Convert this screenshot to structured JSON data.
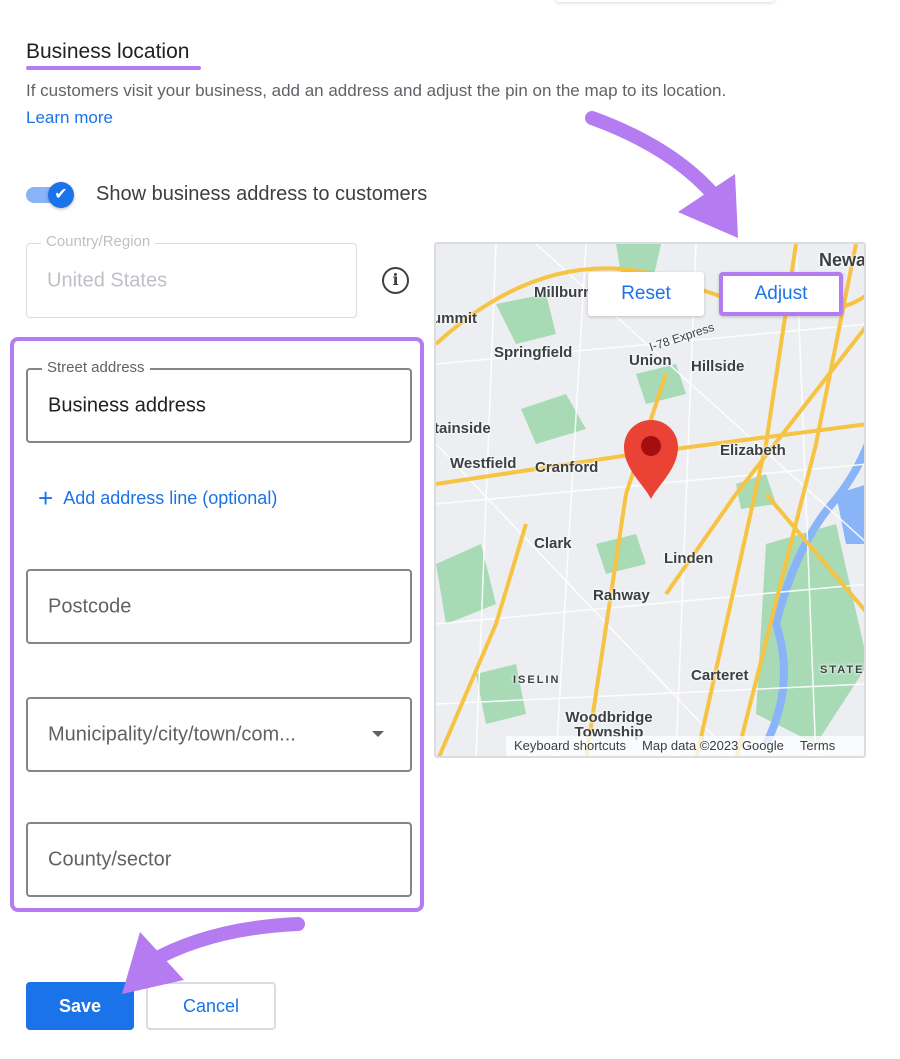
{
  "section": {
    "title": "Business location",
    "description": "If customers visit your business, add an address and adjust the pin on the map to its location.",
    "learn_more": "Learn more"
  },
  "toggle": {
    "label": "Show business address to customers",
    "checked": true
  },
  "country": {
    "label": "Country/Region",
    "value": "United States",
    "disabled": true
  },
  "street": {
    "label": "Street address",
    "value": "Business address"
  },
  "add_line": "Add address line (optional)",
  "postcode": {
    "placeholder": "Postcode"
  },
  "municipality": {
    "placeholder": "Municipality/city/town/com..."
  },
  "county": {
    "placeholder": "County/sector"
  },
  "map": {
    "reset": "Reset",
    "adjust": "Adjust",
    "places": [
      "Newark",
      "Millburn",
      "Summit",
      "Springfield",
      "Union",
      "Hillside",
      "Mountainside",
      "Westfield",
      "Cranford",
      "Elizabeth",
      "Clark",
      "Linden",
      "Rahway",
      "Carteret",
      "ISELIN",
      "Woodbridge Township",
      "STATE",
      "I-78 Express"
    ],
    "attribution": {
      "shortcuts": "Keyboard shortcuts",
      "data": "Map data ©2023 Google",
      "terms": "Terms"
    }
  },
  "buttons": {
    "save": "Save",
    "cancel": "Cancel"
  },
  "colors": {
    "accent": "#1a73e8",
    "annotation": "#b57bf0",
    "pin": "#ea4335"
  }
}
